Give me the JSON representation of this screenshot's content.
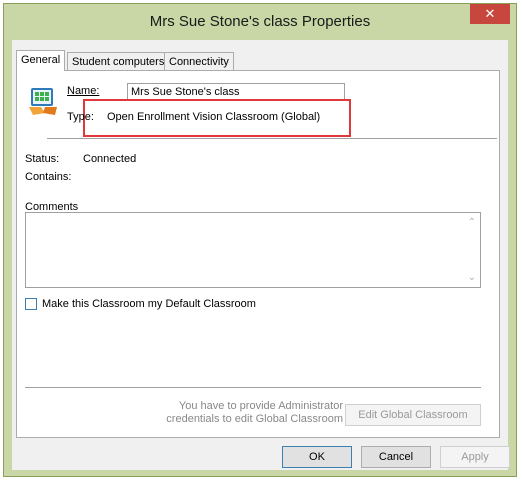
{
  "window": {
    "title": "Mrs Sue Stone's class Properties",
    "close_glyph": "✕",
    "colors": {
      "frame": "#c8d7a5",
      "close": "#c7463d",
      "highlight": "#e0373a"
    }
  },
  "tabs": [
    {
      "label": "General",
      "active": true
    },
    {
      "label": "Student computers",
      "active": false
    },
    {
      "label": "Connectivity",
      "active": false
    }
  ],
  "general": {
    "name_label": "Name:",
    "name_value": "Mrs Sue Stone's class",
    "type_label": "Type:",
    "type_value": "Open Enrollment Vision Classroom (Global)",
    "status_label": "Status:",
    "status_value": "Connected",
    "contains_label": "Contains:",
    "comments_label": "Comments",
    "default_checkbox_label": "Make this Classroom my Default Classroom",
    "default_checked": false,
    "admin_note": "You have to provide Administrator credentials to edit Global Classroom",
    "edit_button": "Edit Global Classroom"
  },
  "footer": {
    "ok": "OK",
    "cancel": "Cancel",
    "apply": "Apply"
  }
}
